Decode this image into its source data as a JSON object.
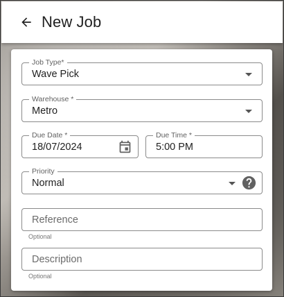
{
  "header": {
    "title": "New Job",
    "back_icon": "arrow-left-icon"
  },
  "form": {
    "job_type": {
      "label": "Job Type*",
      "value": "Wave Pick"
    },
    "warehouse": {
      "label": "Warehouse *",
      "value": "Metro"
    },
    "due_date": {
      "label": "Due Date *",
      "value": "18/07/2024",
      "icon": "calendar-icon"
    },
    "due_time": {
      "label": "Due Time *",
      "value": "5:00 PM"
    },
    "priority": {
      "label": "Priority",
      "value": "Normal",
      "help_icon": "help-circle-icon"
    },
    "reference": {
      "placeholder": "Reference",
      "helper": "Optional"
    },
    "description": {
      "placeholder": "Description",
      "helper": "Optional"
    }
  }
}
